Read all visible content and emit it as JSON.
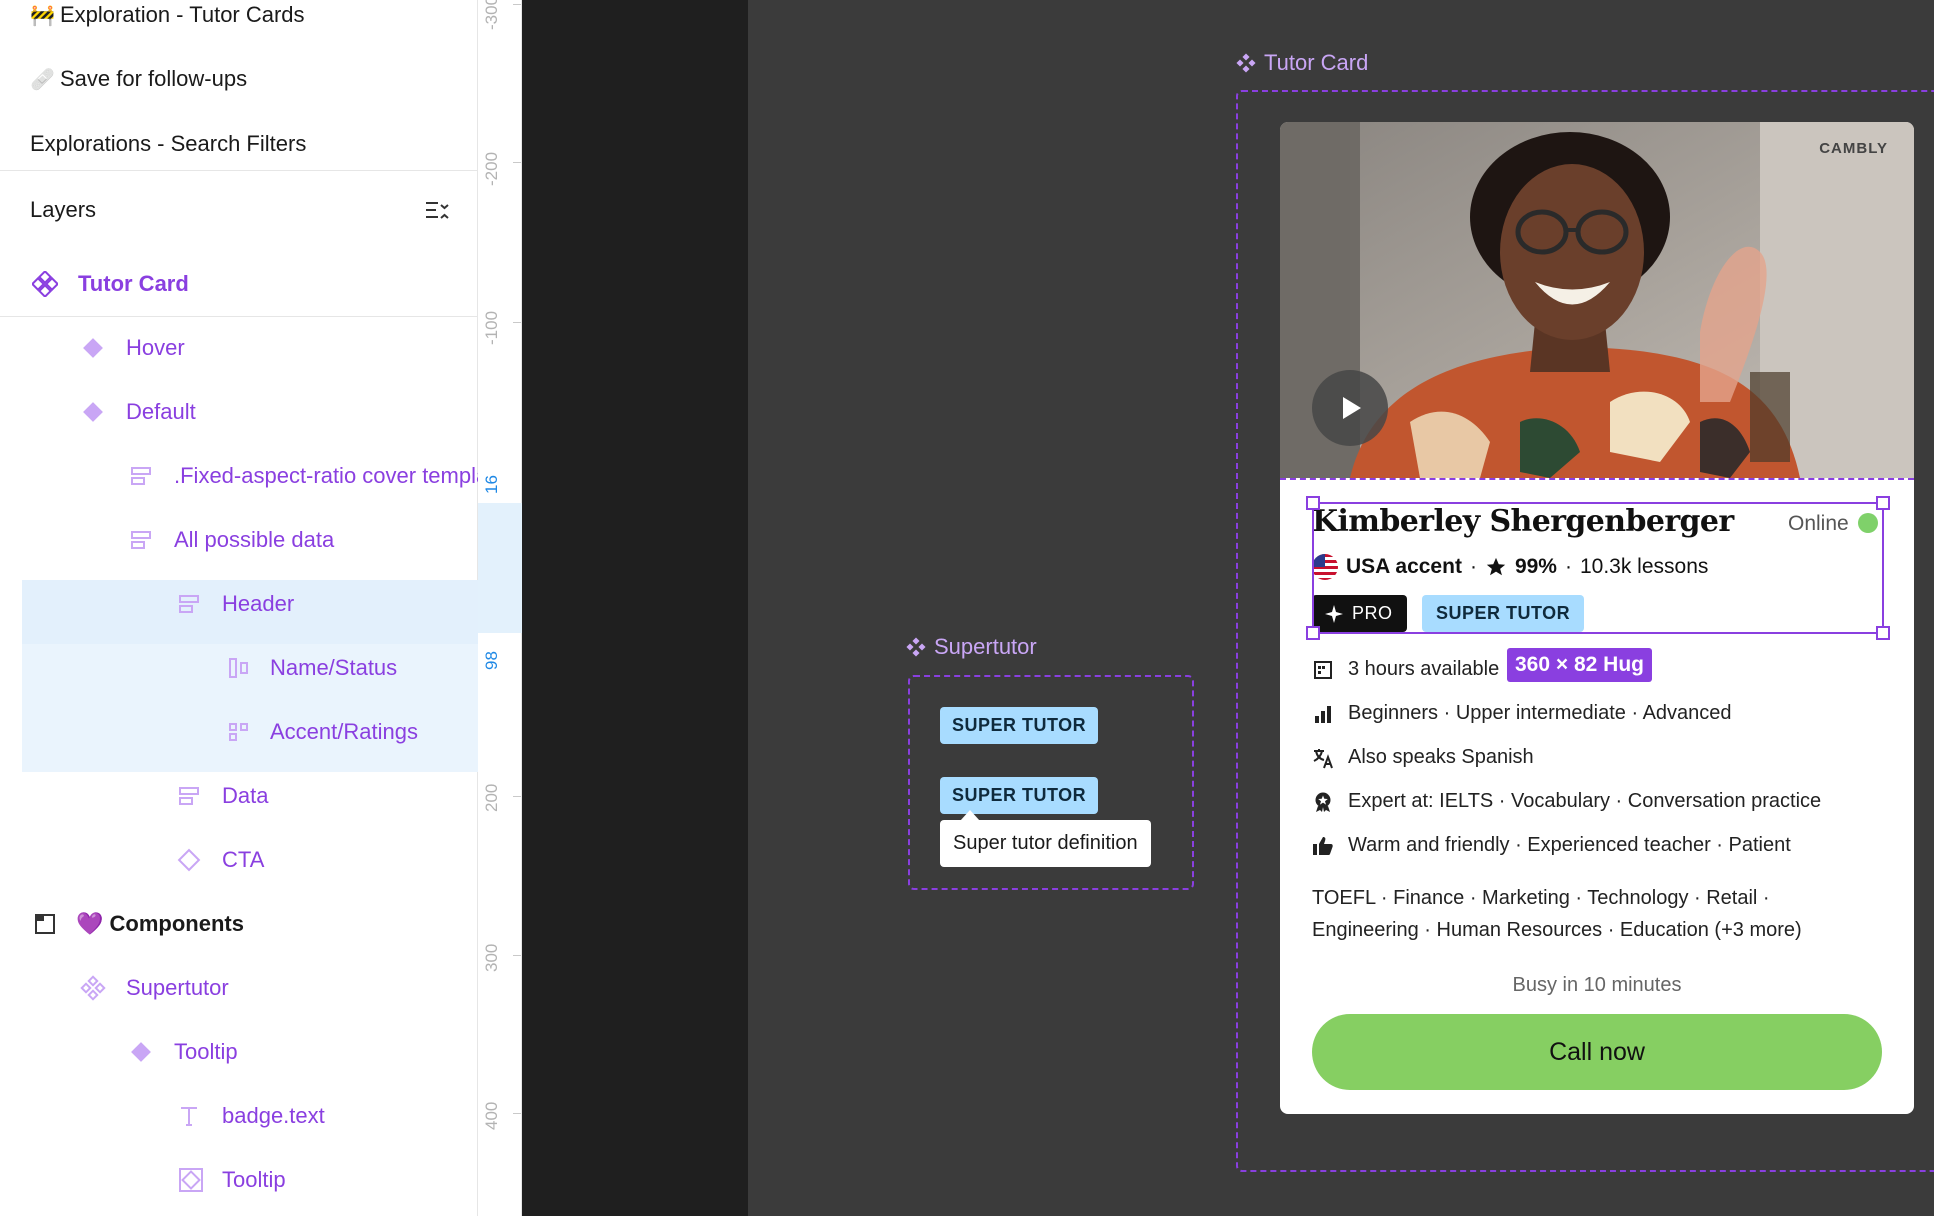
{
  "pages": [
    {
      "emoji": "🚧",
      "label": "Exploration - Tutor Cards"
    },
    {
      "emoji": "🩹",
      "label": "Save for follow-ups"
    },
    {
      "emoji": "",
      "label": "Explorations - Search Filters"
    }
  ],
  "layers": {
    "title": "Layers",
    "root": "Tutor Card",
    "items": [
      {
        "label": "Hover",
        "icon": "variant-diamond-icon"
      },
      {
        "label": "Default",
        "icon": "variant-diamond-icon"
      },
      {
        "label": ".Fixed-aspect-ratio cover template",
        "icon": "frame-rows-icon"
      },
      {
        "label": "All possible data",
        "icon": "frame-rows-icon"
      },
      {
        "label": "Header",
        "icon": "frame-rows-icon"
      },
      {
        "label": "Name/Status",
        "icon": "frame-columns-icon"
      },
      {
        "label": "Accent/Ratings",
        "icon": "grid-icon"
      },
      {
        "label": "Data",
        "icon": "frame-rows-icon"
      },
      {
        "label": "CTA",
        "icon": "instance-diamond-icon"
      }
    ],
    "components_section": {
      "emoji": "💜",
      "label": "Components"
    },
    "components": [
      {
        "label": "Supertutor",
        "icon": "component-icon"
      },
      {
        "label": "Tooltip",
        "icon": "variant-diamond-icon"
      },
      {
        "label": "badge.text",
        "icon": "text-icon"
      },
      {
        "label": "Tooltip",
        "icon": "tooltip-frame-icon"
      }
    ]
  },
  "ruler": {
    "labels": [
      "-300",
      "-200",
      "-100",
      "16",
      "98",
      "200",
      "300",
      "400"
    ]
  },
  "canvas": {
    "supertutor_frame": {
      "label": "Supertutor",
      "badge_1": "SUPER TUTOR",
      "badge_2": "SUPER TUTOR",
      "tooltip": "Super tutor definition"
    },
    "tutor_card_frame": {
      "label": "Tutor Card"
    },
    "selection_size": "360 × 82 Hug"
  },
  "tutor_card": {
    "brand": "CAMBLY",
    "name": "Kimberley Shergenberger",
    "status": "Online",
    "accent": "USA accent",
    "rating": "99%",
    "lessons": "10.3k lessons",
    "pro_badge": "PRO",
    "supertutor_badge": "SUPER TUTOR",
    "availability": "3 hours available",
    "levels": "Beginners · Upper intermediate · Advanced",
    "languages": "Also speaks Spanish",
    "expertise": "Expert at: IELTS · Vocabulary · Conversation practice",
    "traits": "Warm and friendly · Experienced teacher · Patient",
    "topics": "TOEFL · Finance · Marketing · Technology · Retail · Engineering · Human Resources · Education (+3 more)",
    "busy_text": "Busy in 10 minutes",
    "cta_label": "Call now"
  },
  "colors": {
    "selection": "#8a3fe0",
    "component_label": "#c9a6f5",
    "badge_blue": "#a8dcff",
    "online_green": "#7fd16a",
    "cta_green": "#86cf62",
    "canvas_bg": "#3b3b3b"
  }
}
